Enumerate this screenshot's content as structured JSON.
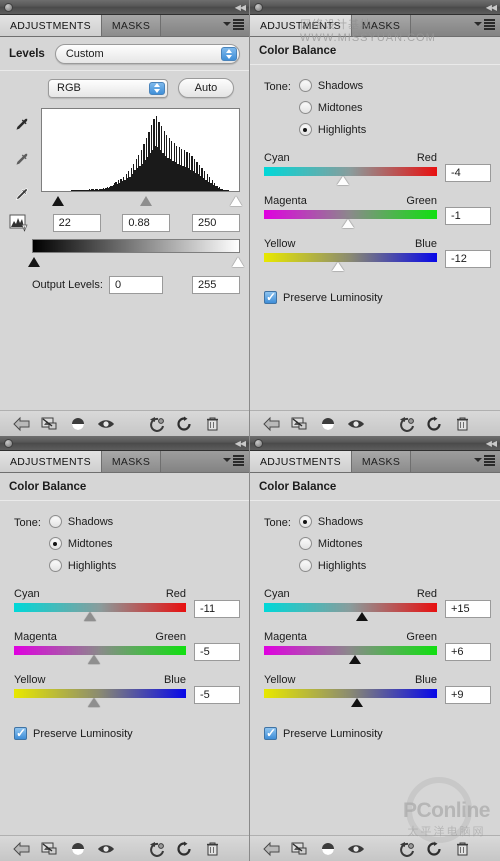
{
  "window": {
    "collapse_glyph": "◀◀"
  },
  "tabs": {
    "adjustments": "ADJUSTMENTS",
    "masks": "MASKS"
  },
  "panels": {
    "levels": {
      "preset_label": "Levels",
      "preset_value": "Custom",
      "channel_value": "RGB",
      "auto_label": "Auto",
      "input_shadow": "22",
      "input_gamma": "0.88",
      "input_highlight": "250",
      "output_label": "Output Levels:",
      "output_black": "0",
      "output_white": "255",
      "histogram": {
        "values": [
          0,
          0,
          0,
          0,
          0,
          0,
          0,
          0,
          0,
          0,
          0,
          0,
          0,
          0,
          0,
          0,
          0,
          0,
          0,
          0,
          0,
          0,
          0,
          1,
          1,
          1,
          2,
          2,
          1,
          2,
          1,
          2,
          2,
          1,
          2,
          2,
          2,
          3,
          2,
          3,
          3,
          2,
          3,
          3,
          2,
          3,
          3,
          3,
          4,
          3,
          4,
          5,
          4,
          5,
          6,
          7,
          8,
          10,
          12,
          9,
          14,
          11,
          16,
          13,
          18,
          15,
          22,
          17,
          26,
          19,
          31,
          23,
          36,
          28,
          42,
          30,
          48,
          33,
          55,
          36,
          62,
          41,
          70,
          45,
          78,
          50,
          88,
          55,
          96,
          60,
          100,
          58,
          92,
          54,
          86,
          50,
          80,
          46,
          74,
          44,
          70,
          42,
          66,
          40,
          63,
          38,
          60,
          36,
          58,
          34,
          56,
          33,
          54,
          32,
          52,
          30,
          50,
          28,
          46,
          26,
          42,
          24,
          38,
          22,
          34,
          20,
          30,
          17,
          26,
          15,
          22,
          12,
          18,
          10,
          14,
          8,
          10,
          6,
          7,
          4,
          5,
          3,
          3,
          2,
          2,
          1,
          1,
          1,
          0,
          0,
          0,
          0,
          0,
          0,
          0,
          0
        ]
      },
      "slider_positions": {
        "black": 8.6,
        "gray": 53,
        "white": 98
      },
      "icons": {
        "dropper_black": "black-point-eyedropper-icon",
        "dropper_gray": "gray-point-eyedropper-icon",
        "dropper_white": "white-point-eyedropper-icon",
        "refresh": "refresh-histogram-icon"
      }
    },
    "color_balance_highlights": {
      "title": "Color Balance",
      "tone_label": "Tone:",
      "tones": [
        {
          "label": "Shadows",
          "selected": false
        },
        {
          "label": "Midtones",
          "selected": false
        },
        {
          "label": "Highlights",
          "selected": true
        }
      ],
      "sliders": [
        {
          "left": "Cyan",
          "right": "Red",
          "value": "-4",
          "pos": 45.5,
          "thumb": "light"
        },
        {
          "left": "Magenta",
          "right": "Green",
          "value": "-1",
          "pos": 48.8,
          "thumb": "light"
        },
        {
          "left": "Yellow",
          "right": "Blue",
          "value": "-12",
          "pos": 43.0,
          "thumb": "light"
        }
      ],
      "preserve_label": "Preserve Luminosity",
      "preserve_checked": true
    },
    "color_balance_midtones": {
      "title": "Color Balance",
      "tone_label": "Tone:",
      "tones": [
        {
          "label": "Shadows",
          "selected": false
        },
        {
          "label": "Midtones",
          "selected": true
        },
        {
          "label": "Highlights",
          "selected": false
        }
      ],
      "sliders": [
        {
          "left": "Cyan",
          "right": "Red",
          "value": "-11",
          "pos": 44.0,
          "thumb": "mid"
        },
        {
          "left": "Magenta",
          "right": "Green",
          "value": "-5",
          "pos": 46.5,
          "thumb": "mid"
        },
        {
          "left": "Yellow",
          "right": "Blue",
          "value": "-5",
          "pos": 46.5,
          "thumb": "mid"
        }
      ],
      "preserve_label": "Preserve Luminosity",
      "preserve_checked": true
    },
    "color_balance_shadows": {
      "title": "Color Balance",
      "tone_label": "Tone:",
      "tones": [
        {
          "label": "Shadows",
          "selected": true
        },
        {
          "label": "Midtones",
          "selected": false
        },
        {
          "label": "Highlights",
          "selected": false
        }
      ],
      "sliders": [
        {
          "left": "Cyan",
          "right": "Red",
          "value": "+15",
          "pos": 56.5,
          "thumb": "dark"
        },
        {
          "left": "Magenta",
          "right": "Green",
          "value": "+6",
          "pos": 52.5,
          "thumb": "dark"
        },
        {
          "left": "Yellow",
          "right": "Blue",
          "value": "+9",
          "pos": 54.0,
          "thumb": "dark"
        }
      ],
      "preserve_label": "Preserve Luminosity",
      "preserve_checked": true
    }
  },
  "toolbar": {
    "icons": [
      "return-to-adjustment-list-icon",
      "clip-to-layer-icon",
      "view-previous-state-icon",
      "toggle-layer-visibility-icon",
      "reset-to-previous-icon",
      "reset-adjustment-icon",
      "delete-adjustment-layer-icon"
    ]
  },
  "watermarks": {
    "top_cn": "网络设计基地",
    "top_url": "WWW.MISSYUAN.COM",
    "bottom_brand": "PConline",
    "bottom_cn": "太平洋电脑网"
  },
  "colors": {
    "panel_bg": "#d6d6d6",
    "tab_active": "#dcdcdc",
    "accent_blue": "#3e8ed8",
    "cyan": "#00d8d8",
    "red": "#e81010",
    "magenta": "#e000e0",
    "green": "#10e010",
    "yellow": "#e8e800",
    "blue": "#0808e8"
  }
}
